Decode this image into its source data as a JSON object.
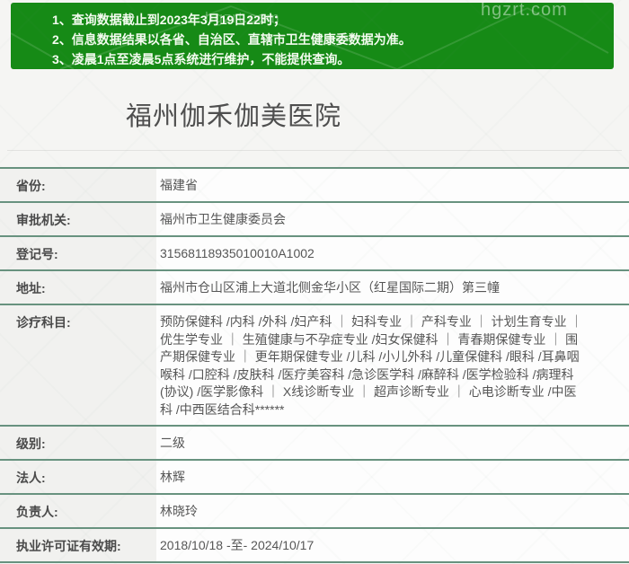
{
  "notice": {
    "lines": [
      "1、查询数据截止到2023年3月19日22时；",
      "2、信息数据结果以各省、自治区、直辖市卫生健康委数据为准。",
      "3、凌晨1点至凌晨5点系统进行维护，不能提供查询。"
    ]
  },
  "watermark": {
    "text": "hgzrt.com"
  },
  "page": {
    "title": "福州伽禾伽美医院"
  },
  "info": {
    "rows": [
      {
        "label": "省份:",
        "value": "福建省"
      },
      {
        "label": "审批机关:",
        "value": "福州市卫生健康委员会"
      },
      {
        "label": "登记号:",
        "value": "31568118935010010A1002"
      },
      {
        "label": "地址:",
        "value": "福州市仓山区浦上大道北侧金华小区（红星国际二期）第三幢"
      },
      {
        "label": "诊疗科目:",
        "value": "预防保健科 /内科 /外科 /妇产科 ｜ 妇科专业 ｜ 产科专业 ｜ 计划生育专业 ｜ 优生学专业 ｜ 生殖健康与不孕症专业 /妇女保健科 ｜ 青春期保健专业 ｜ 围产期保健专业 ｜ 更年期保健专业 /儿科 /小儿外科 /儿童保健科 /眼科 /耳鼻咽喉科 /口腔科 /皮肤科 /医疗美容科 /急诊医学科 /麻醉科 /医学检验科 /病理科(协议) /医学影像科 ｜ X线诊断专业 ｜ 超声诊断专业 ｜ 心电诊断专业 /中医科 /中西医结合科******"
      },
      {
        "label": "级别:",
        "value": "二级"
      },
      {
        "label": "法人:",
        "value": "林辉"
      },
      {
        "label": "负责人:",
        "value": "林晓玲"
      },
      {
        "label": "执业许可证有效期:",
        "value": "2018/10/18 -至- 2024/10/17"
      }
    ]
  },
  "colors": {
    "notice_bg": "#168a16",
    "notice_text": "#f3fbef",
    "divider": "#68927f",
    "page_bg": "#f5f5f3",
    "label_bg": "#f1f1ef",
    "value_bg": "#fdfdfd",
    "label_text": "#4a4a4a",
    "value_text": "#565656",
    "title_text": "#4e4e4e"
  }
}
